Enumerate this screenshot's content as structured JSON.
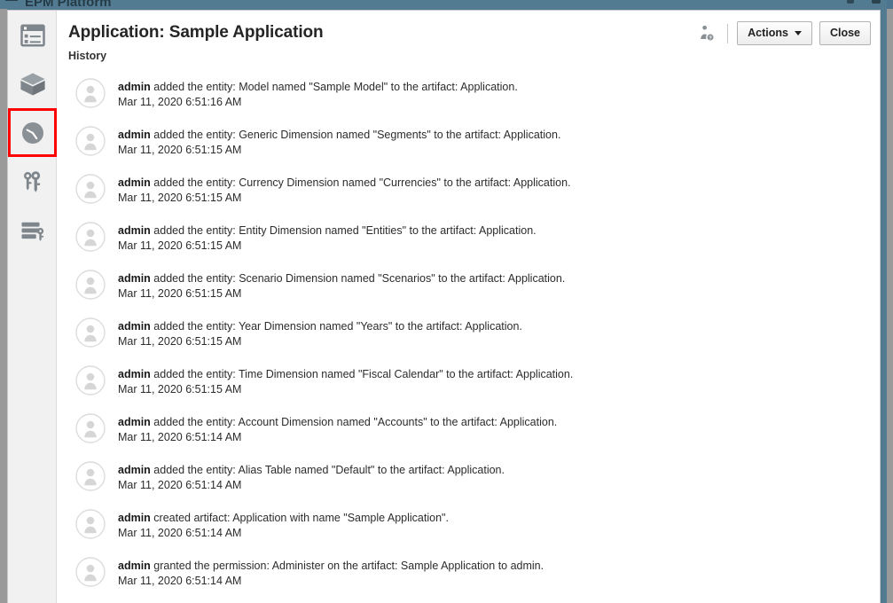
{
  "app_band": {
    "title_fragment": "EPM Platform",
    "menu_icon": "hamburger-icon",
    "accent_color": "#527b92"
  },
  "sidebar": {
    "items": [
      {
        "icon": "list-view-icon",
        "label": "Dimensions",
        "selected": false
      },
      {
        "icon": "cube-icon",
        "label": "Cubes",
        "selected": false
      },
      {
        "icon": "clock-history-icon",
        "label": "History",
        "selected": true
      },
      {
        "icon": "keys-icon",
        "label": "Permissions",
        "selected": false
      },
      {
        "icon": "database-key-icon",
        "label": "Data Access",
        "selected": false
      }
    ],
    "highlight_color": "#ff0000"
  },
  "header": {
    "title": "Application: Sample Application",
    "subtitle": "History",
    "user_info_icon": "user-info-icon",
    "actions_label": "Actions",
    "close_label": "Close"
  },
  "history": {
    "entries": [
      {
        "actor": "admin",
        "text": " added the entity: Model named \"Sample Model\" to the artifact: Application.",
        "timestamp": "Mar 11, 2020 6:51:16 AM"
      },
      {
        "actor": "admin",
        "text": " added the entity: Generic Dimension named \"Segments\" to the artifact: Application.",
        "timestamp": "Mar 11, 2020 6:51:15 AM"
      },
      {
        "actor": "admin",
        "text": " added the entity: Currency Dimension named \"Currencies\" to the artifact: Application.",
        "timestamp": "Mar 11, 2020 6:51:15 AM"
      },
      {
        "actor": "admin",
        "text": " added the entity: Entity Dimension named \"Entities\" to the artifact: Application.",
        "timestamp": "Mar 11, 2020 6:51:15 AM"
      },
      {
        "actor": "admin",
        "text": " added the entity: Scenario Dimension named \"Scenarios\" to the artifact: Application.",
        "timestamp": "Mar 11, 2020 6:51:15 AM"
      },
      {
        "actor": "admin",
        "text": " added the entity: Year Dimension named \"Years\" to the artifact: Application.",
        "timestamp": "Mar 11, 2020 6:51:15 AM"
      },
      {
        "actor": "admin",
        "text": " added the entity: Time Dimension named \"Fiscal Calendar\" to the artifact: Application.",
        "timestamp": "Mar 11, 2020 6:51:15 AM"
      },
      {
        "actor": "admin",
        "text": " added the entity: Account Dimension named \"Accounts\" to the artifact: Application.",
        "timestamp": "Mar 11, 2020 6:51:14 AM"
      },
      {
        "actor": "admin",
        "text": " added the entity: Alias Table named \"Default\" to the artifact: Application.",
        "timestamp": "Mar 11, 2020 6:51:14 AM"
      },
      {
        "actor": "admin",
        "text": " created artifact: Application with name \"Sample Application\".",
        "timestamp": "Mar 11, 2020 6:51:14 AM"
      },
      {
        "actor": "admin",
        "text": " granted the permission: Administer on the artifact: Sample Application to admin.",
        "timestamp": "Mar 11, 2020 6:51:14 AM"
      }
    ],
    "avatar_icon": "user-avatar-icon"
  },
  "scrollbars": {
    "left_rail": "vertical-scrollbar",
    "right_rail": "vertical-scrollbar"
  }
}
